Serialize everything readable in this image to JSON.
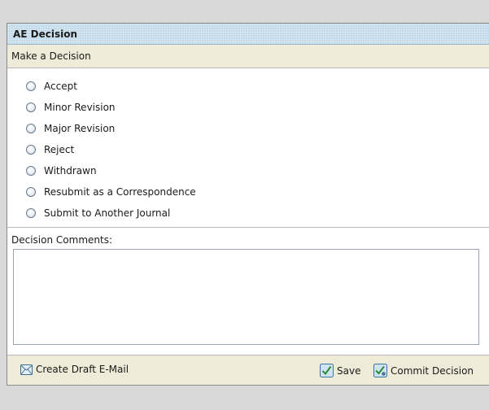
{
  "panel": {
    "title": "AE Decision"
  },
  "decision": {
    "section_title": "Make a Decision",
    "options": [
      {
        "label": "Accept"
      },
      {
        "label": "Minor Revision"
      },
      {
        "label": "Major Revision"
      },
      {
        "label": "Reject"
      },
      {
        "label": "Withdrawn"
      },
      {
        "label": "Resubmit as a Correspondence"
      },
      {
        "label": "Submit to Another Journal"
      }
    ]
  },
  "comments": {
    "label": "Decision Comments:",
    "value": ""
  },
  "footer": {
    "create_draft_label": "Create Draft E-Mail",
    "save_label": "Save",
    "commit_label": "Commit Decision"
  },
  "icons": {
    "email": "envelope-icon",
    "save": "checkmark-icon",
    "commit": "checkmark-seal-icon"
  },
  "colors": {
    "header_bg": "#bcd6e7",
    "section_bg": "#eeecd9",
    "page_bg": "#d8d8d8"
  }
}
